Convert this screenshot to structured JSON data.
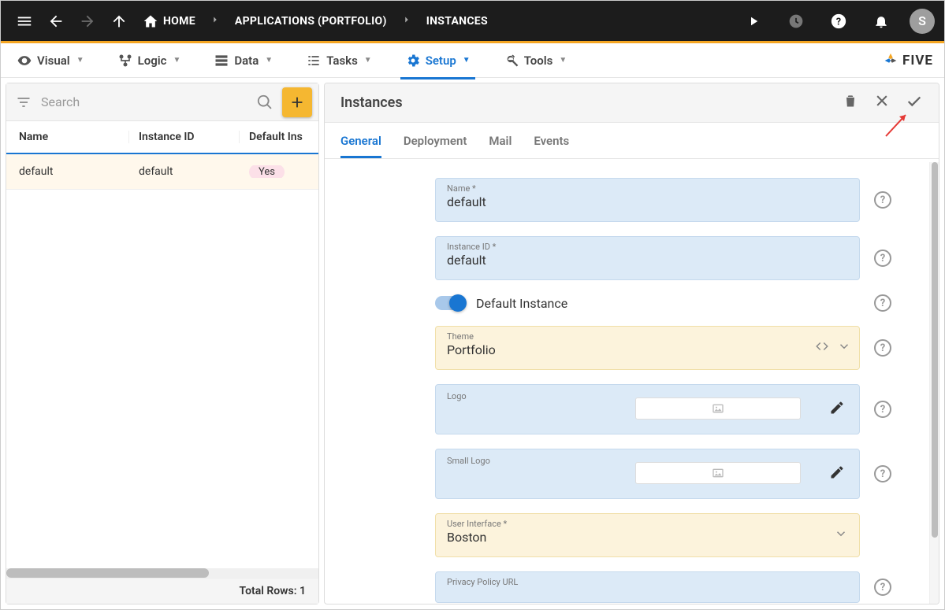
{
  "topbar": {
    "home": "HOME",
    "crumb1": "APPLICATIONS (PORTFOLIO)",
    "crumb2": "INSTANCES",
    "avatar_letter": "S"
  },
  "toolbar": {
    "items": [
      {
        "label": "Visual"
      },
      {
        "label": "Logic"
      },
      {
        "label": "Data"
      },
      {
        "label": "Tasks"
      },
      {
        "label": "Setup",
        "active": true
      },
      {
        "label": "Tools"
      }
    ],
    "brand": "FIVE"
  },
  "left": {
    "search_placeholder": "Search",
    "columns": {
      "name": "Name",
      "id": "Instance ID",
      "def": "Default Ins"
    },
    "rows": [
      {
        "name": "default",
        "id": "default",
        "def": "Yes"
      }
    ],
    "footer": "Total Rows: 1"
  },
  "right": {
    "title": "Instances",
    "tabs": [
      "General",
      "Deployment",
      "Mail",
      "Events"
    ],
    "active_tab": 0,
    "fields": {
      "name_label": "Name *",
      "name_value": "default",
      "instanceid_label": "Instance ID *",
      "instanceid_value": "default",
      "default_instance_label": "Default Instance",
      "theme_label": "Theme",
      "theme_value": "Portfolio",
      "logo_label": "Logo",
      "small_logo_label": "Small Logo",
      "ui_label": "User Interface *",
      "ui_value": "Boston",
      "privacy_label": "Privacy Policy URL"
    }
  }
}
